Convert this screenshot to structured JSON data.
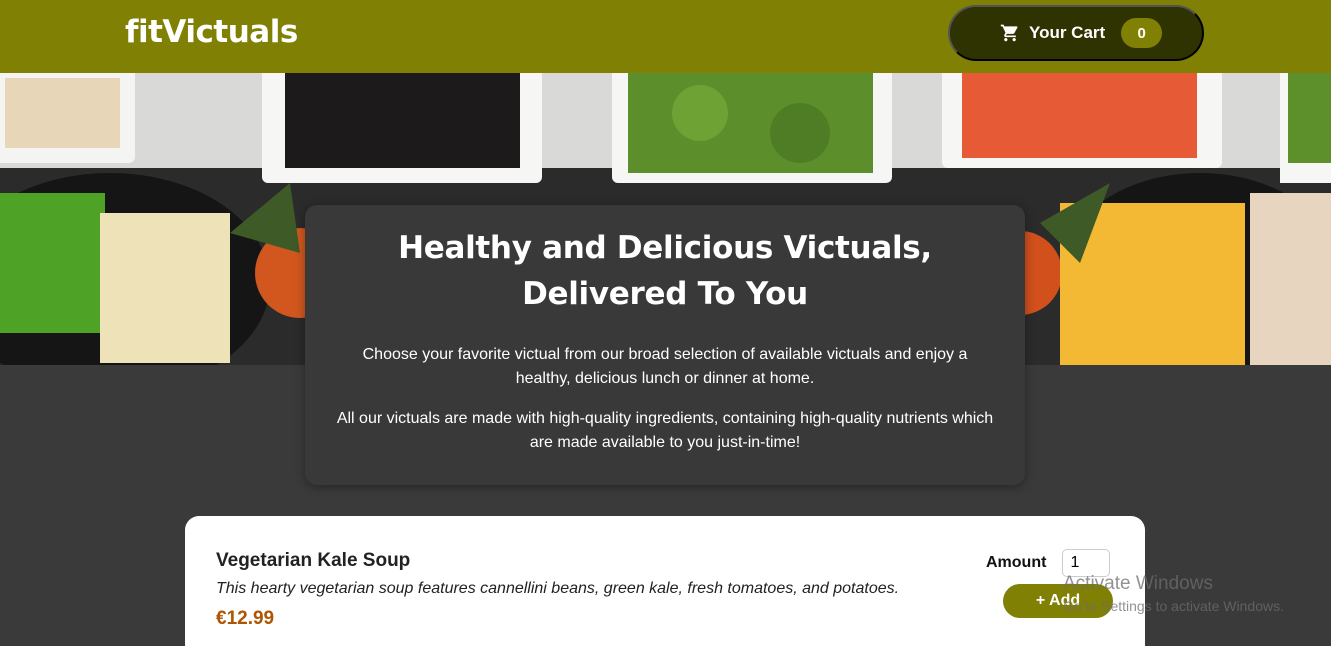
{
  "header": {
    "logo": "fitVictuals",
    "cart": {
      "label": "Your Cart",
      "count": "0",
      "icon": "cart-icon"
    }
  },
  "hero": {
    "image": "food-banner-image"
  },
  "intro": {
    "title": "Healthy and Delicious Victuals, Delivered To You",
    "paragraph1": "Choose your favorite victual from our broad selection of available victuals and enjoy a healthy, delicious lunch or dinner at home.",
    "paragraph2": "All our victuals are made with high-quality ingredients, containing high-quality nutrients which are made available to you just-in-time!"
  },
  "meals": [
    {
      "name": "Vegetarian Kale Soup",
      "description": "This hearty vegetarian soup features cannellini beans, green kale, fresh tomatoes, and potatoes.",
      "price": "€12.99",
      "amount_label": "Amount",
      "amount_value": "1",
      "add_label": "+ Add"
    }
  ],
  "watermark": {
    "title": "Activate Windows",
    "subtitle": "Go to Settings to activate Windows."
  },
  "colors": {
    "brand": "#808004",
    "cart_dark": "#2f3201",
    "price": "#ad5502",
    "background": "#3a3a3a"
  }
}
